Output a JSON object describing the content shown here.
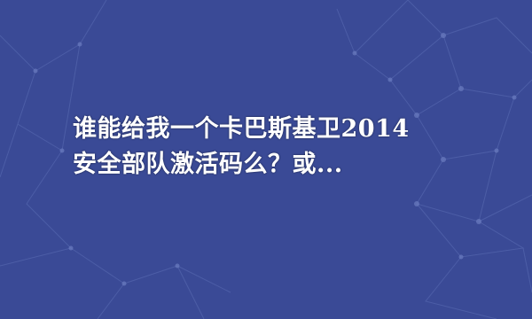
{
  "background_color": "#3a4a96",
  "pattern_color": "#5668b0",
  "title": {
    "line1": "谁能给我一个卡巴斯基卫2014",
    "line2": "安全部队激活码么？或..."
  }
}
